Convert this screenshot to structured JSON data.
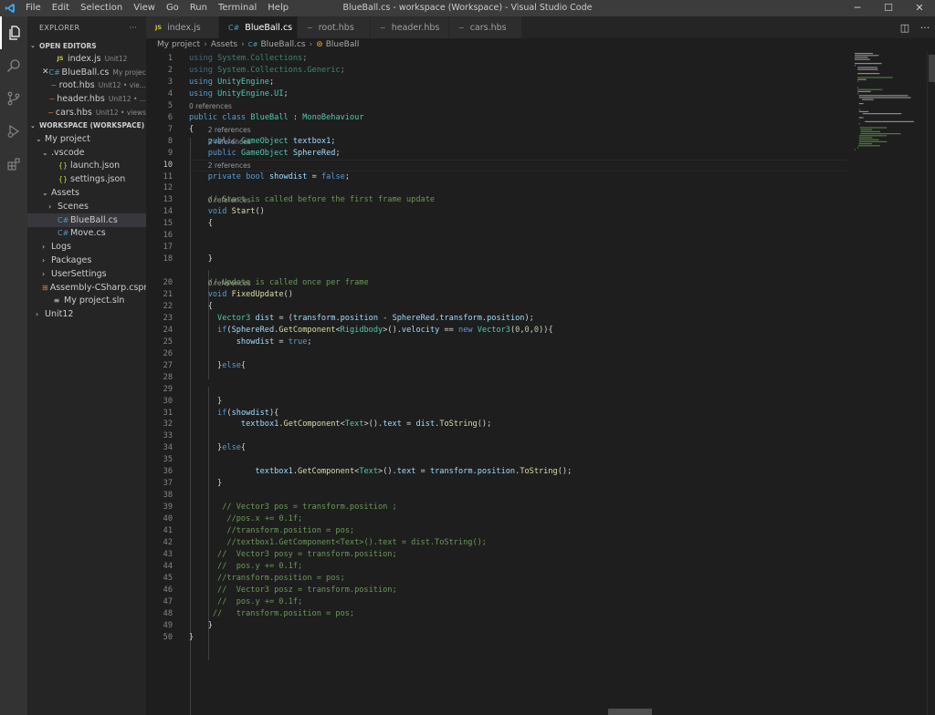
{
  "titlebar": {
    "menu": [
      "File",
      "Edit",
      "Selection",
      "View",
      "Go",
      "Run",
      "Terminal",
      "Help"
    ],
    "title": "BlueBall.cs - workspace (Workspace) - Visual Studio Code",
    "minimize": "─",
    "maximize": "☐",
    "close": "✕"
  },
  "activity_bar": [
    "explorer-icon",
    "search-icon",
    "source-control-icon",
    "run-debug-icon",
    "extensions-icon"
  ],
  "sidebar": {
    "title": "EXPLORER",
    "more": "···",
    "open_editors_title": "OPEN EDITORS",
    "open_editors": [
      {
        "icon": "JS",
        "name": "index.js",
        "desc": "Unit12",
        "close": ""
      },
      {
        "icon": "C#",
        "name": "BlueBall.cs",
        "desc": "My project...",
        "close": "✕"
      },
      {
        "icon": "~",
        "name": "root.hbs",
        "desc": "Unit12 • vie...",
        "close": ""
      },
      {
        "icon": "~",
        "name": "header.hbs",
        "desc": "Unit12 • ...",
        "close": ""
      },
      {
        "icon": "~",
        "name": "cars.hbs",
        "desc": "Unit12 • views",
        "close": ""
      }
    ],
    "workspace_title": "WORKSPACE (WORKSPACE)",
    "tree": [
      {
        "chev": "⌄",
        "icon": "",
        "name": "My project",
        "indent": 1
      },
      {
        "chev": "⌄",
        "icon": "",
        "name": ".vscode",
        "indent": 2
      },
      {
        "chev": "",
        "icon": "{}",
        "name": "launch.json",
        "indent": 3
      },
      {
        "chev": "",
        "icon": "{}",
        "name": "settings.json",
        "indent": 3
      },
      {
        "chev": "⌄",
        "icon": "",
        "name": "Assets",
        "indent": 2
      },
      {
        "chev": "›",
        "icon": "",
        "name": "Scenes",
        "indent": 3
      },
      {
        "chev": "",
        "icon": "C#",
        "name": "BlueBall.cs",
        "indent": 3
      },
      {
        "chev": "",
        "icon": "C#",
        "name": "Move.cs",
        "indent": 3
      },
      {
        "chev": "›",
        "icon": "",
        "name": "Logs",
        "indent": 2
      },
      {
        "chev": "›",
        "icon": "",
        "name": "Packages",
        "indent": 2
      },
      {
        "chev": "›",
        "icon": "",
        "name": "UserSettings",
        "indent": 2
      },
      {
        "chev": "",
        "icon": "⊞",
        "name": "Assembly-CSharp.csproj",
        "indent": 2
      },
      {
        "chev": "",
        "icon": "≡",
        "name": "My project.sln",
        "indent": 2
      },
      {
        "chev": "›",
        "icon": "",
        "name": "Unit12",
        "indent": 1
      }
    ]
  },
  "tabs": [
    {
      "icon": "JS",
      "label": "index.js",
      "close": "",
      "active": false
    },
    {
      "icon": "C#",
      "label": "BlueBall.cs",
      "close": "✕",
      "active": true
    },
    {
      "icon": "~",
      "label": "root.hbs",
      "close": "",
      "active": false
    },
    {
      "icon": "~",
      "label": "header.hbs",
      "close": "",
      "active": false
    },
    {
      "icon": "~",
      "label": "cars.hbs",
      "close": "",
      "active": false
    }
  ],
  "tab_actions": {
    "split": "◫",
    "more": "···"
  },
  "breadcrumb": [
    "My project",
    "Assets",
    "BlueBall.cs",
    "BlueBall"
  ],
  "editor": {
    "current_line": 10,
    "lines": [
      {
        "n": 1,
        "lens": "",
        "html": "<span class='kw'>using</span> <span class='ty'>System.Collections</span>;",
        "dim": true
      },
      {
        "n": 2,
        "lens": "",
        "html": "<span class='kw'>using</span> <span class='ty'>System.Collections.Generic</span>;",
        "dim": true
      },
      {
        "n": 3,
        "lens": "",
        "html": "<span class='kw'>using</span> <span class='ty'>UnityEngine</span>;"
      },
      {
        "n": 4,
        "lens": "",
        "html": "<span class='kw'>using</span> <span class='ty'>UnityEngine.UI</span>;"
      },
      {
        "n": 5,
        "lens": "",
        "html": ""
      },
      {
        "n": 6,
        "lens": "0 references",
        "html": "<span class='kw'>public</span> <span class='kw'>class</span> <span class='ty'>BlueBall</span> : <span class='ty'>MonoBehaviour</span>"
      },
      {
        "n": 7,
        "lens": "",
        "html": "{"
      },
      {
        "n": 8,
        "lens": "2 references",
        "html": "    <span class='kw'>public</span> <span class='ty'>GameObject</span> <span class='va'>textbox1</span>;"
      },
      {
        "n": 9,
        "lens": "2 references",
        "html": "    <span class='kw'>public</span> <span class='ty'>GameObject</span> <span class='va'>SphereRed</span>;"
      },
      {
        "n": 10,
        "lens": "",
        "html": ""
      },
      {
        "n": 11,
        "lens": "2 references",
        "html": "    <span class='kw'>private</span> <span class='kw'>bool</span> <span class='va'>showdist</span> = <span class='kw'>false</span>;"
      },
      {
        "n": 12,
        "lens": "",
        "html": ""
      },
      {
        "n": 13,
        "lens": "",
        "html": "    <span class='cm'>// Start is called before the first frame update</span>"
      },
      {
        "n": 14,
        "lens": "0 references",
        "html": "    <span class='kw'>void</span> <span class='fn'>Start</span>()"
      },
      {
        "n": 15,
        "lens": "",
        "html": "    {"
      },
      {
        "n": 16,
        "lens": "",
        "html": ""
      },
      {
        "n": 17,
        "lens": "",
        "html": ""
      },
      {
        "n": 18,
        "lens": "",
        "html": "    }"
      },
      {
        "n": 20,
        "lens": "",
        "html": "    <span class='cm'>// Update is called once per frame</span>"
      },
      {
        "n": 21,
        "lens": "0 references",
        "html": "    <span class='kw'>void</span> <span class='fn'>FixedUpdate</span>()"
      },
      {
        "n": 22,
        "lens": "",
        "html": "    {"
      },
      {
        "n": 23,
        "lens": "",
        "html": "      <span class='ty'>Vector3</span> <span class='va'>dist</span> = (<span class='va'>transform</span>.<span class='va'>position</span> - <span class='va'>SphereRed</span>.<span class='va'>transform</span>.<span class='va'>position</span>);"
      },
      {
        "n": 24,
        "lens": "",
        "html": "      <span class='kw'>if</span>(<span class='va'>SphereRed</span>.<span class='fn'>GetComponent</span>&lt;<span class='ty'>Rigidbody</span>&gt;().<span class='va'>velocity</span> == <span class='kw'>new</span> <span class='ty'>Vector3</span>(<span class='nu'>0</span>,<span class='nu'>0</span>,<span class='nu'>0</span>)){"
      },
      {
        "n": 25,
        "lens": "",
        "html": "          <span class='va'>showdist</span> = <span class='kw'>true</span>;"
      },
      {
        "n": 26,
        "lens": "",
        "html": ""
      },
      {
        "n": 27,
        "lens": "",
        "html": "      }<span class='kw'>else</span>{"
      },
      {
        "n": 28,
        "lens": "",
        "html": ""
      },
      {
        "n": 29,
        "lens": "",
        "html": ""
      },
      {
        "n": 30,
        "lens": "",
        "html": "      }"
      },
      {
        "n": 31,
        "lens": "",
        "html": "      <span class='kw'>if</span>(<span class='va'>showdist</span>){"
      },
      {
        "n": 32,
        "lens": "",
        "html": "           <span class='va'>textbox1</span>.<span class='fn'>GetComponent</span>&lt;<span class='ty'>Text</span>&gt;().<span class='va'>text</span> = <span class='va'>dist</span>.<span class='fn'>ToString</span>();"
      },
      {
        "n": 33,
        "lens": "",
        "html": ""
      },
      {
        "n": 34,
        "lens": "",
        "html": "      }<span class='kw'>else</span>{"
      },
      {
        "n": 35,
        "lens": "",
        "html": ""
      },
      {
        "n": 36,
        "lens": "",
        "html": "              <span class='va'>textbox1</span>.<span class='fn'>GetComponent</span>&lt;<span class='ty'>Text</span>&gt;().<span class='va'>text</span> = <span class='va'>transform</span>.<span class='va'>position</span>.<span class='fn'>ToString</span>();"
      },
      {
        "n": 37,
        "lens": "",
        "html": "      }"
      },
      {
        "n": 38,
        "lens": "",
        "html": ""
      },
      {
        "n": 39,
        "lens": "",
        "html": "       <span class='cm'>// Vector3 pos = transform.position ;</span>"
      },
      {
        "n": 40,
        "lens": "",
        "html": "        <span class='cm'>//pos.x += 0.1f;</span>"
      },
      {
        "n": 41,
        "lens": "",
        "html": "        <span class='cm'>//transform.position = pos;</span>"
      },
      {
        "n": 42,
        "lens": "",
        "html": "        <span class='cm'>//textbox1.GetComponent&lt;Text&gt;().text = dist.ToString();</span>"
      },
      {
        "n": 43,
        "lens": "",
        "html": "      <span class='cm'>//  Vector3 posy = transform.position;</span>"
      },
      {
        "n": 44,
        "lens": "",
        "html": "      <span class='cm'>//  pos.y += 0.1f;</span>"
      },
      {
        "n": 45,
        "lens": "",
        "html": "      <span class='cm'>//transform.position = pos;</span>"
      },
      {
        "n": 46,
        "lens": "",
        "html": "      <span class='cm'>//  Vector3 posz = transform.position;</span>"
      },
      {
        "n": 47,
        "lens": "",
        "html": "      <span class='cm'>//  pos.y += 0.1f;</span>"
      },
      {
        "n": 48,
        "lens": "",
        "html": "     <span class='cm'>//   transform.position = pos;</span>"
      },
      {
        "n": 49,
        "lens": "",
        "html": "    }"
      },
      {
        "n": 50,
        "lens": "",
        "html": "}"
      }
    ]
  },
  "colors": {
    "editor_bg": "#1e1e1e",
    "sidebar_bg": "#252526",
    "activity_bg": "#333333",
    "titlebar_bg": "#3c3c3c",
    "keyword": "#569cd6",
    "type": "#4ec9b0",
    "comment": "#6a9955"
  }
}
